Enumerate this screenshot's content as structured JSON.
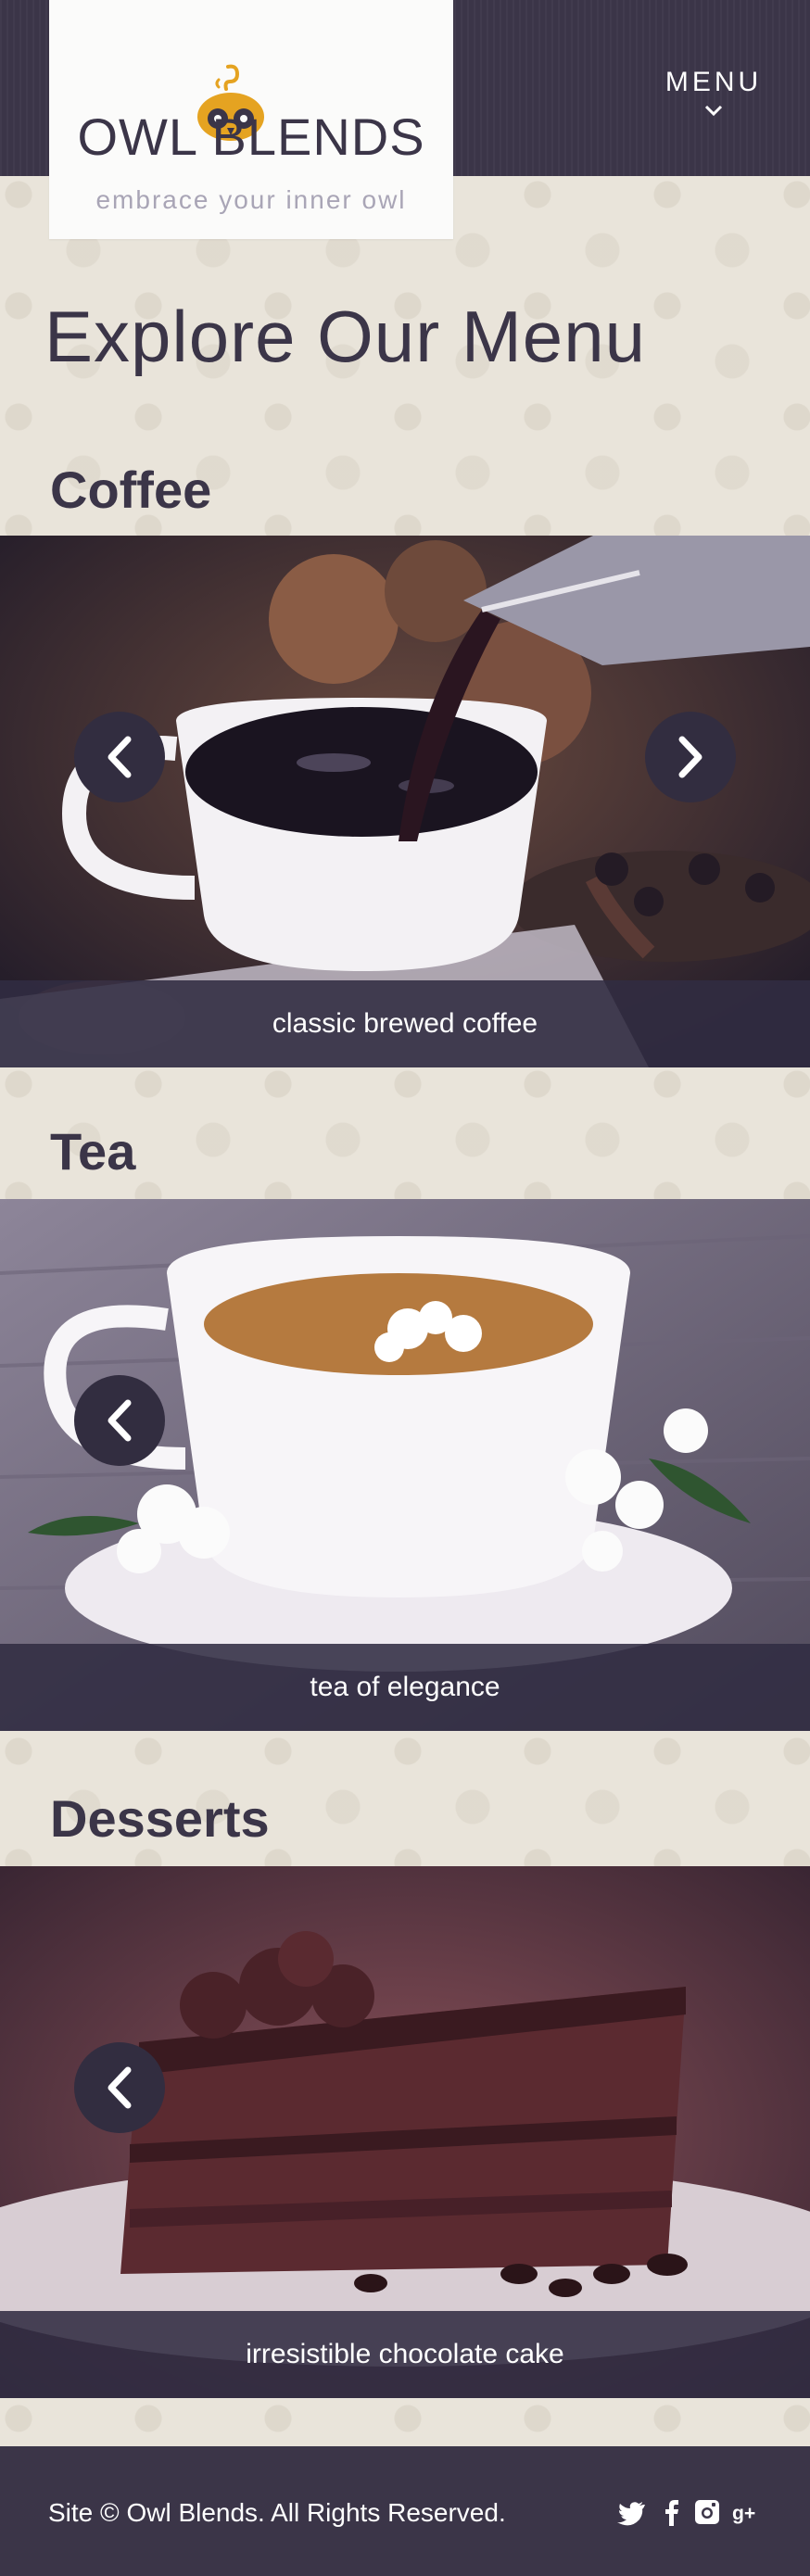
{
  "brand": {
    "name": "OWL BLENDS",
    "tagline": "embrace your inner owl"
  },
  "nav": {
    "menu_label": "MENU"
  },
  "page": {
    "title": "Explore Our Menu"
  },
  "sections": [
    {
      "title": "Coffee",
      "caption": "classic brewed coffee"
    },
    {
      "title": "Tea",
      "caption": "tea of elegance"
    },
    {
      "title": "Desserts",
      "caption": "irresistible chocolate cake"
    }
  ],
  "footer": {
    "copyright": "Site © Owl Blends. All Rights Reserved.",
    "social": [
      "twitter-icon",
      "facebook-icon",
      "instagram-icon",
      "google-plus-icon"
    ]
  },
  "colors": {
    "primary": "#3b3548",
    "accent": "#e5a321",
    "background": "#e9e4da"
  }
}
